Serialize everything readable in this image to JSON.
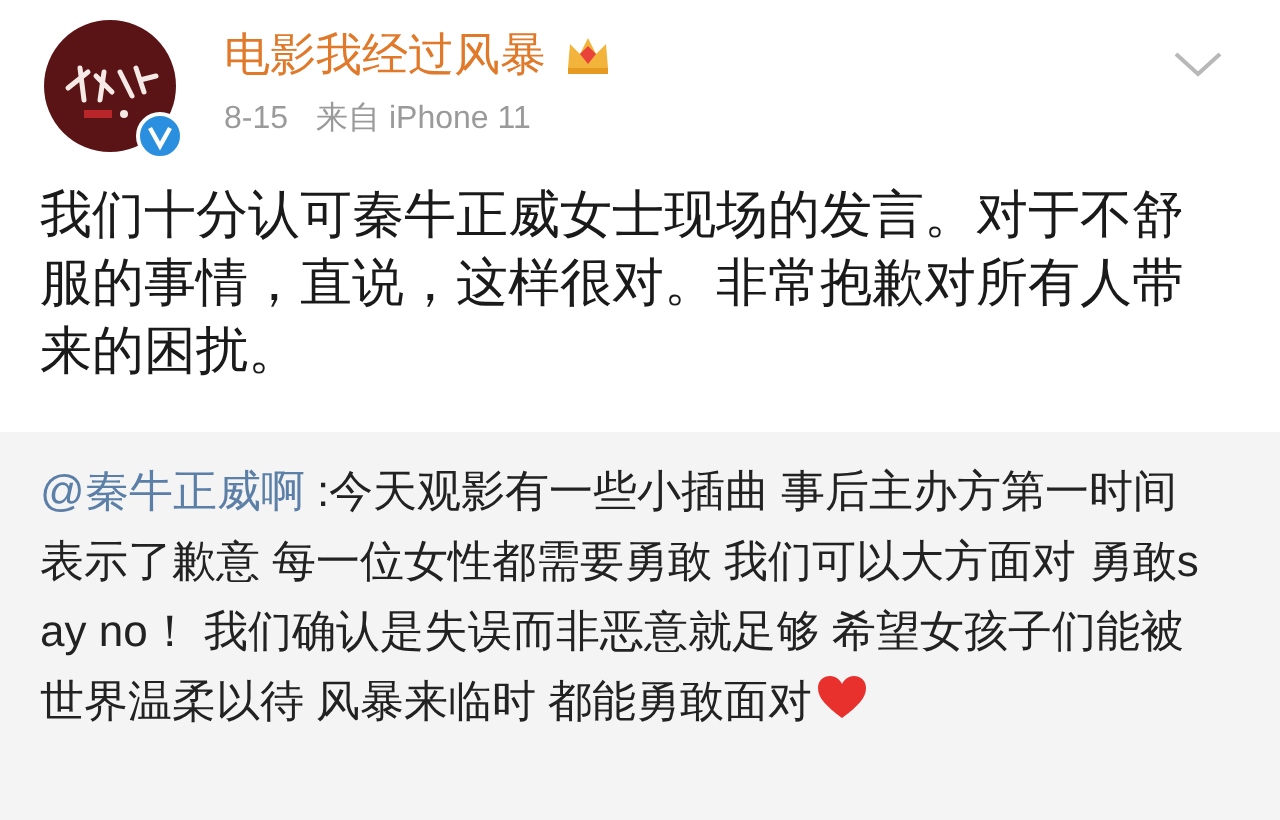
{
  "post": {
    "author": "电影我经过风暴",
    "verified": true,
    "date": "8-15",
    "source": "来自 iPhone 11",
    "text": "我们十分认可秦牛正威女士现场的发言。对于不舒服的事情，直说，这样很对。非常抱歉对所有人带来的困扰。"
  },
  "quoted": {
    "mention": "@秦牛正威啊",
    "text": ":今天观影有一些小插曲 事后主办方第一时间表示了歉意 每一位女性都需要勇敢 我们可以大方面对 勇敢say no！ 我们确认是失误而非恶意就足够 希望女孩子们能被世界温柔以待 风暴来临时 都能勇敢面对"
  }
}
